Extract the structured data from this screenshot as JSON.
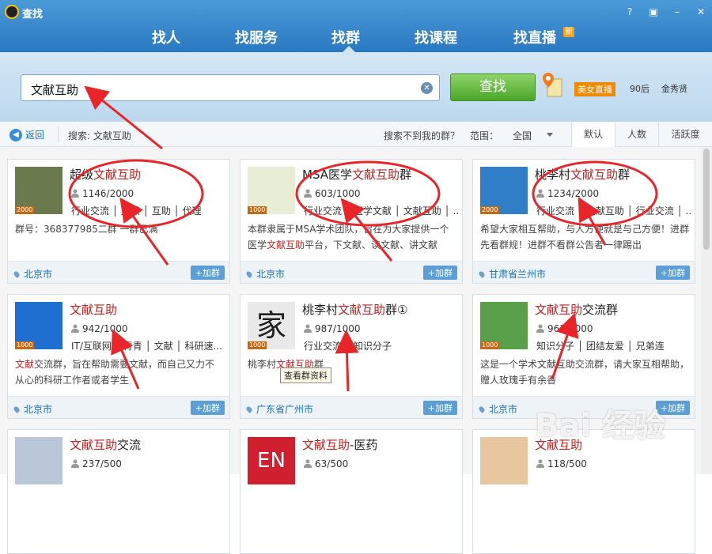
{
  "window": {
    "title": "查找",
    "btn_help": "?",
    "btn_min": "–",
    "btn_max": "□",
    "btn_close": "✕"
  },
  "nav": {
    "items": [
      "找人",
      "找服务",
      "找群",
      "找课程",
      "找直播"
    ],
    "active": "找群",
    "new_badge": "新"
  },
  "search": {
    "value": "文献互助",
    "button": "查找",
    "live": "美女直播",
    "tag1": "90后",
    "tag2": "金秀贤"
  },
  "toolbar": {
    "back": "返回",
    "search_label": "搜索: 文献互助",
    "notfound": "搜索不到我的群？",
    "range_label": "范围：",
    "range_value": "全国",
    "sort": [
      "默认",
      "人数",
      "活跃度"
    ]
  },
  "cards": [
    {
      "title_pre": "超级",
      "title_hl": "文献互助",
      "title_post": "",
      "count": "1146/2000",
      "tags": "行业交流 │ 文献 │ 互助 │ 代理",
      "desc_pre": "群号：368377985二群 一群已满",
      "desc_hl": "",
      "desc_post": "",
      "location": "北京市",
      "join": "+加群",
      "badge": "2000"
    },
    {
      "title_pre": "MSA医学",
      "title_hl": "文献互助",
      "title_post": "群",
      "count": "603/1000",
      "tags": "行业交流 │ 医学文献 │ 文献互助 │ ...",
      "desc_pre": "本群隶属于MSA学术团队，旨在为大家提供一个医学",
      "desc_hl": "文献互助",
      "desc_post": "平台，下文献、读文献、讲文献",
      "location": "北京市",
      "join": "+加群",
      "badge": "1000"
    },
    {
      "title_pre": "桃李村",
      "title_hl": "文献互助",
      "title_post": "群",
      "count": "1234/2000",
      "tags": "行业交流 │ 文献互助 │ 行业交流 │ ...",
      "desc_pre": "希望大家相互帮助，与人方便就是与己方便！进群先看群规！进群不看群公告者一律踢出",
      "desc_hl": "",
      "desc_post": "",
      "location": "甘肃省兰州市",
      "join": "+加群",
      "badge": "2000"
    },
    {
      "title_pre": "",
      "title_hl": "文献互助",
      "title_post": "",
      "count": "942/1000",
      "tags": "IT/互联网 │ 青青 │ 文献 │ 科研速...",
      "desc_pre": "",
      "desc_hl": "文献",
      "desc_post": "交流群，旨在帮助需要文献，而自己又力不从心的科研工作者或者学生",
      "location": "北京市",
      "join": "+加群",
      "badge": "1000"
    },
    {
      "title_pre": "桃李村",
      "title_hl": "文献互助",
      "title_post": "群①",
      "count": "987/1000",
      "tags": "行业交流 │ 知识分子",
      "desc_pre": "桃李村",
      "desc_hl": "文献互助",
      "desc_post": "群",
      "location": "广东省广州市",
      "join": "+加群",
      "badge": "1000"
    },
    {
      "title_pre": "",
      "title_hl": "文献互助",
      "title_post": "交流群",
      "count": "961/1000",
      "tags": "知识分子 │ 团结友爱 │ 兄弟连",
      "desc_pre": "这是一个学术文献互助交流群，请大家互相帮助，赠人玫瑰手有余香",
      "desc_hl": "",
      "desc_post": "",
      "location": "北京市",
      "join": "+加群",
      "badge": "1000"
    },
    {
      "title_pre": "",
      "title_hl": "文献互助",
      "title_post": "交流",
      "count": "237/500",
      "tags": "",
      "desc_pre": "",
      "desc_hl": "",
      "desc_post": "",
      "location": "",
      "join": "",
      "badge": ""
    },
    {
      "title_pre": "",
      "title_hl": "文献互助",
      "title_post": "-医药",
      "count": "63/500",
      "tags": "",
      "desc_pre": "",
      "desc_hl": "",
      "desc_post": "",
      "location": "",
      "join": "",
      "badge": ""
    },
    {
      "title_pre": "",
      "title_hl": "文献互助",
      "title_post": "",
      "count": "118/500",
      "tags": "",
      "desc_pre": "",
      "desc_hl": "",
      "desc_post": "",
      "location": "",
      "join": "",
      "badge": ""
    }
  ],
  "tooltip": "查看群资料",
  "watermark": "Bai 经验",
  "colors": {
    "header": "#2a78c2",
    "highlight": "#c81e1e",
    "button_green": "#4ba62a",
    "link": "#1a6fb5",
    "arrow": "#e8262a"
  }
}
